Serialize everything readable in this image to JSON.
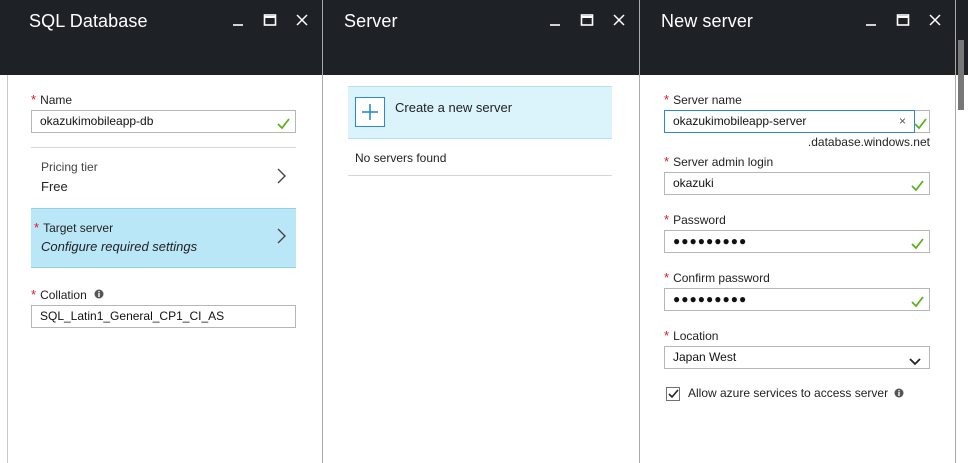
{
  "blades": {
    "sql_database": {
      "title": "SQL Database",
      "name_label": "Name",
      "name_value": "okazukimobileapp-db",
      "pricing_label": "Pricing tier",
      "pricing_value": "Free",
      "target_label": "Target server",
      "target_value": "Configure required settings",
      "collation_label": "Collation",
      "collation_value": "SQL_Latin1_General_CP1_CI_AS"
    },
    "server": {
      "title": "Server",
      "create_label": "Create a new server",
      "empty_text": "No servers found"
    },
    "new_server": {
      "title": "New server",
      "server_name_label": "Server name",
      "server_name_value": "okazukimobileapp-server",
      "domain_suffix": ".database.windows.net",
      "admin_label": "Server admin login",
      "admin_value": "okazuki",
      "password_label": "Password",
      "password_value": "●●●●●●●●●",
      "confirm_label": "Confirm password",
      "confirm_value": "●●●●●●●●●",
      "location_label": "Location",
      "location_value": "Japan West",
      "allow_label": "Allow azure services to access server",
      "allow_checked": true
    }
  },
  "colors": {
    "header_bg": "#1e2126",
    "required": "#e81123",
    "valid_check": "#5cb21c",
    "selected_row": "#b9e7f7",
    "accent_blue": "#2b88d8"
  }
}
